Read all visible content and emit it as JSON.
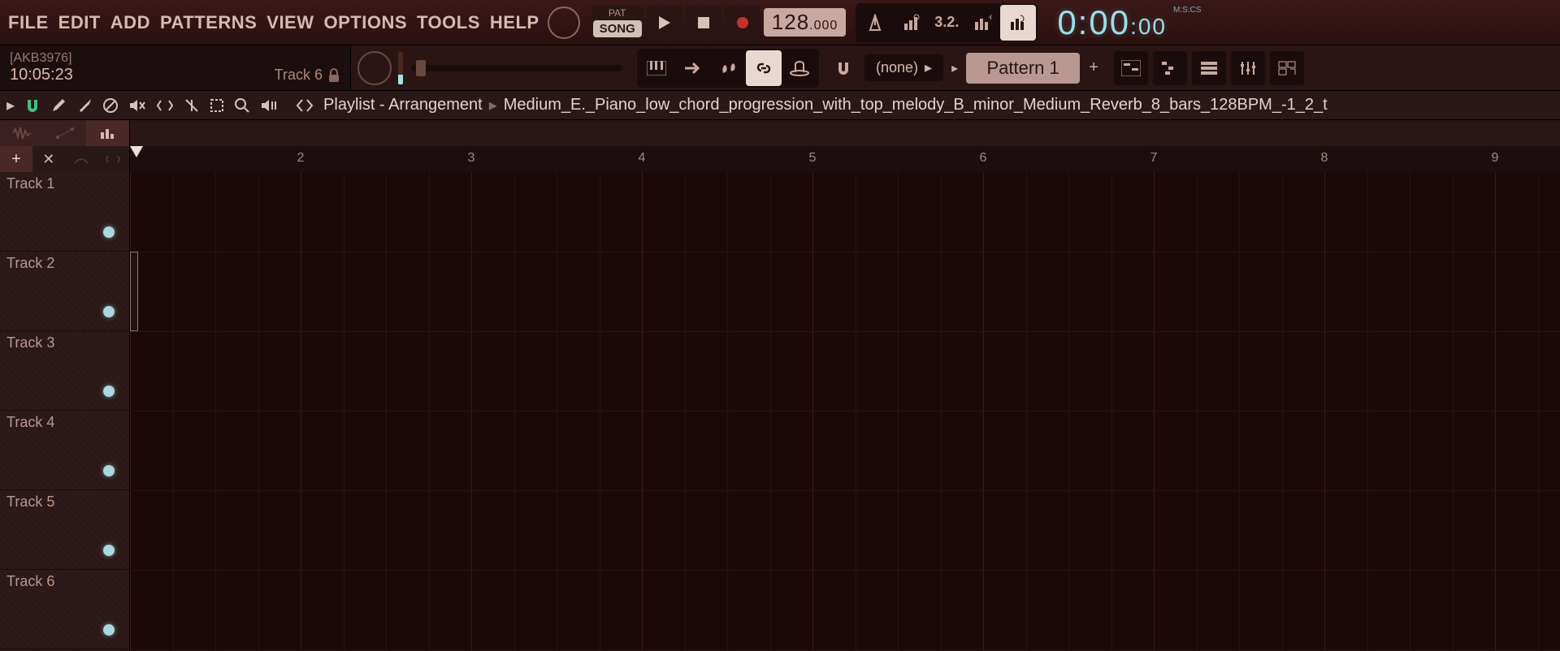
{
  "menu": [
    "FILE",
    "EDIT",
    "ADD",
    "PATTERNS",
    "VIEW",
    "OPTIONS",
    "TOOLS",
    "HELP"
  ],
  "patSong": {
    "pat": "PAT",
    "song": "SONG"
  },
  "tempo": {
    "int": "128",
    "frac": ".000"
  },
  "time": {
    "main": "0:00",
    "cs": ":00",
    "label": "M:S:CS"
  },
  "hint": {
    "tag": "[AKB3976]",
    "time": "10:05:23",
    "track": "Track 6"
  },
  "snap": "(none)",
  "pattern": "Pattern 1",
  "playlist": {
    "title": "Playlist - Arrangement",
    "file": "Medium_E._Piano_low_chord_progression_with_top_melody_B_minor_Medium_Reverb_8_bars_128BPM_-1_2_t"
  },
  "rulerNumbers": [
    "2",
    "3",
    "4",
    "5",
    "6",
    "7",
    "8",
    "9"
  ],
  "tracks": [
    "Track 1",
    "Track 2",
    "Track 3",
    "Track 4",
    "Track 5",
    "Track 6"
  ]
}
